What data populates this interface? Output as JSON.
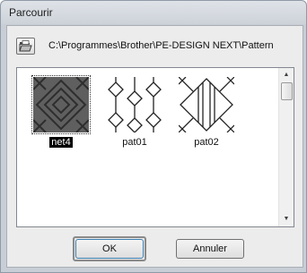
{
  "window": {
    "title": "Parcourir"
  },
  "toolbar": {
    "folder_icon": "folder-open-icon",
    "path": "C:\\Programmes\\Brother\\PE-DESIGN NEXT\\Pattern"
  },
  "files": [
    {
      "name": "net4",
      "selected": true,
      "icon": "pattern-net4-thumbnail"
    },
    {
      "name": "pat01",
      "selected": false,
      "icon": "pattern-pat01-thumbnail"
    },
    {
      "name": "pat02",
      "selected": false,
      "icon": "pattern-pat02-thumbnail"
    }
  ],
  "scrollbar": {
    "up_glyph": "▲",
    "down_glyph": "▼"
  },
  "buttons": {
    "ok": "OK",
    "cancel": "Annuler"
  }
}
